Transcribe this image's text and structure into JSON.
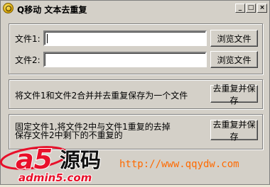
{
  "window": {
    "title": "Q移动 文本去重复",
    "controls": {
      "minimize": "_",
      "maximize": "□",
      "close": "×"
    }
  },
  "files": {
    "file1_label": "文件1:",
    "file2_label": "文件2:",
    "file1_value": "",
    "file2_value": "",
    "browse_label": "浏览文件"
  },
  "merge": {
    "description": "将文件1和文件2合并并去重复保存为一个文件",
    "button_label": "去重复并保存"
  },
  "fixed": {
    "description_line1": "固定文件1,将文件2中与文件1重复的去掉",
    "description_line2": "保存文件2中剩下的不重复的",
    "button_label": "去重复并保存"
  },
  "watermark": {
    "logo_text": "a5",
    "logo_cn": "源码",
    "domain": "admin5.com",
    "url": "http://www.qqydw.com"
  },
  "colors": {
    "window_bg": "#d4d0c8",
    "watermark_red": "#e8102a",
    "watermark_orange": "#ff6a00"
  }
}
